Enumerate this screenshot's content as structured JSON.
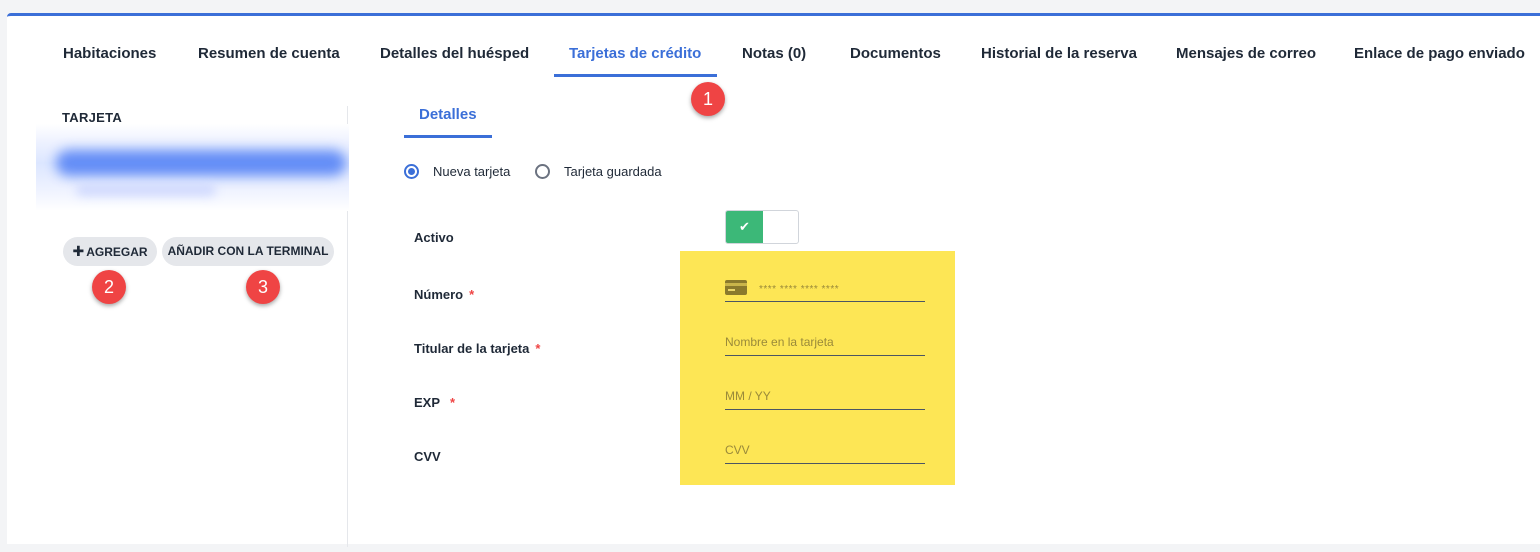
{
  "tabs": [
    {
      "label": "Habitaciones"
    },
    {
      "label": "Resumen de cuenta"
    },
    {
      "label": "Detalles del huésped"
    },
    {
      "label": "Tarjetas de crédito"
    },
    {
      "label": "Notas (0)"
    },
    {
      "label": "Documentos"
    },
    {
      "label": "Historial de la reserva"
    },
    {
      "label": "Mensajes de correo"
    },
    {
      "label": "Enlace de pago enviado"
    }
  ],
  "active_tab": "Tarjetas de crédito",
  "annotations": [
    "1",
    "2",
    "3"
  ],
  "left": {
    "title": "TARJETA",
    "add_label": "AGREGAR",
    "terminal_label": "AÑADIR CON LA TERMINAL"
  },
  "subtab": "Detalles",
  "radios": {
    "new_card": "Nueva tarjeta",
    "saved_card": "Tarjeta guardada",
    "selected": "new_card"
  },
  "form": {
    "active_label": "Activo",
    "active_value": true,
    "number_label": "Número",
    "number_placeholder": "**** **** **** ****",
    "holder_label": "Titular de la tarjeta",
    "holder_placeholder": "Nombre en la tarjeta",
    "exp_label": "EXP",
    "exp_placeholder": "MM / YY",
    "cvv_label": "CVV",
    "cvv_placeholder": "CVV",
    "required_mark": "*"
  },
  "colors": {
    "accent": "#3b6fd8",
    "annotation": "#ef4444",
    "highlight": "#fde655",
    "toggle_on": "#3cb878"
  },
  "icons": {
    "toggle": "check-icon",
    "add": "plus-icon",
    "card_number": "credit-card-icon"
  }
}
